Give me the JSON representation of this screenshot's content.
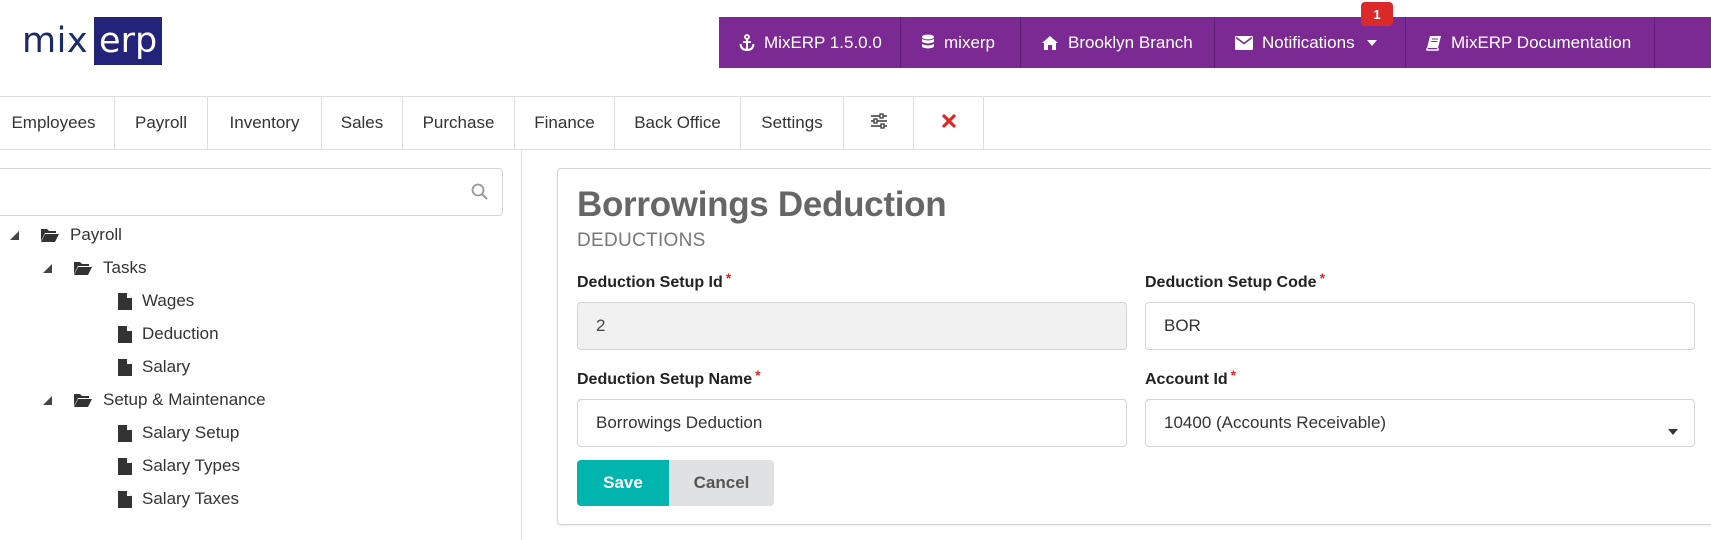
{
  "logo": {
    "part1": "mix",
    "part2": "erp"
  },
  "topbar": {
    "version": "MixERP 1.5.0.0",
    "database": "mixerp",
    "branch": "Brooklyn Branch",
    "notifications": "Notifications",
    "notification_count": "1",
    "documentation": "MixERP Documentation"
  },
  "nav": {
    "items": [
      "Employees",
      "Payroll",
      "Inventory",
      "Sales",
      "Purchase",
      "Finance",
      "Back Office",
      "Settings"
    ]
  },
  "sidebar": {
    "search_placeholder": "",
    "tree": {
      "root": "Payroll",
      "tasks": "Tasks",
      "wages": "Wages",
      "deduction": "Deduction",
      "salary": "Salary",
      "setup": "Setup & Maintenance",
      "salary_setup": "Salary Setup",
      "salary_types": "Salary Types",
      "salary_taxes": "Salary Taxes"
    }
  },
  "form": {
    "title": "Borrowings Deduction",
    "subtitle": "DEDUCTIONS",
    "id_label": "Deduction Setup Id",
    "id_value": "2",
    "code_label": "Deduction Setup Code",
    "code_value": "BOR",
    "name_label": "Deduction Setup Name",
    "name_value": "Borrowings Deduction",
    "account_label": "Account Id",
    "account_value": "10400 (Accounts Receivable)",
    "required_mark": "*",
    "save_label": "Save",
    "cancel_label": "Cancel"
  },
  "colors": {
    "topbar": "#7a2a92",
    "save_button": "#00b5ad",
    "required": "#db2828",
    "badge": "#db2828"
  }
}
